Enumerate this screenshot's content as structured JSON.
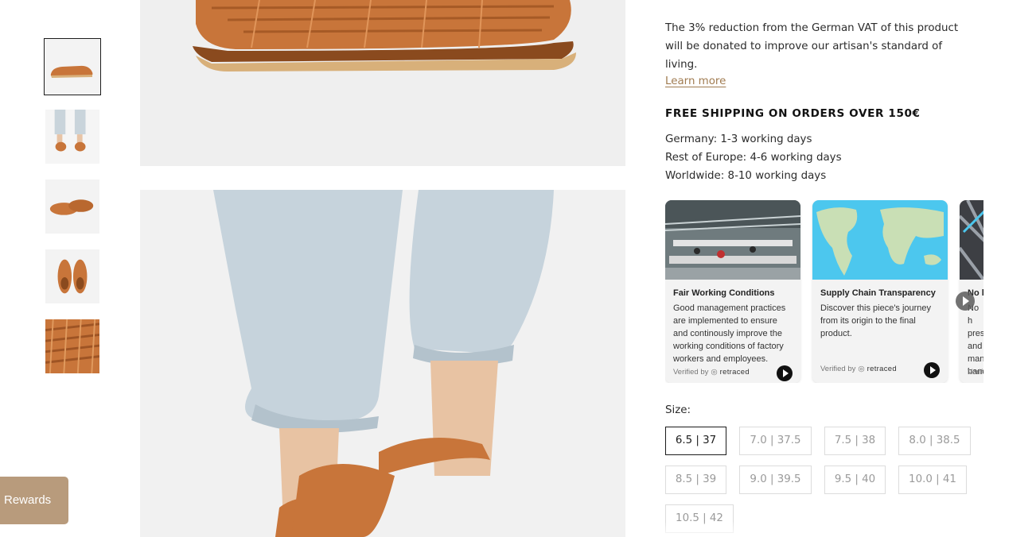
{
  "rewards": {
    "label": "Rewards"
  },
  "product_info": {
    "vat_text": "The 3% reduction from the German VAT of this product will be donated to improve our artisan's standard of living.",
    "learn_more": "Learn more",
    "shipping_heading": "FREE SHIPPING ON ORDERS OVER 150€",
    "shipping_times": [
      "Germany: 1-3 working days",
      "Rest of Europe: 4-6 working days",
      "Worldwide: 8-10 working days"
    ]
  },
  "cards": [
    {
      "title": "Fair Working Conditions",
      "body": "Good management practices are implemented to ensure and continously improve the working conditions of factory workers and employees.",
      "verified_prefix": "Verified by",
      "verified_brand": "retraced"
    },
    {
      "title": "Supply Chain Transparency",
      "body": "Discover this piece's journey from its origin to the final product.",
      "verified_prefix": "Verified by",
      "verified_brand": "retraced"
    },
    {
      "title": "No l",
      "body": "No h pres and man hand",
      "verified_prefix": "Verif",
      "verified_brand": ""
    }
  ],
  "sizes": {
    "label": "Size:",
    "options": [
      "6.5 | 37",
      "7.0 | 37.5",
      "7.5 | 38",
      "8.0 | 38.5",
      "8.5 | 39",
      "9.0 | 39.5",
      "9.5 | 40",
      "10.0 | 41",
      "10.5 | 42"
    ],
    "selected": "6.5 | 37"
  },
  "colors": {
    "accent": "#a07b50",
    "rewards_bg": "#b89b7c",
    "leather": "#c8753a",
    "map_water": "#4cc7ee",
    "map_land": "#c9dfb5"
  }
}
